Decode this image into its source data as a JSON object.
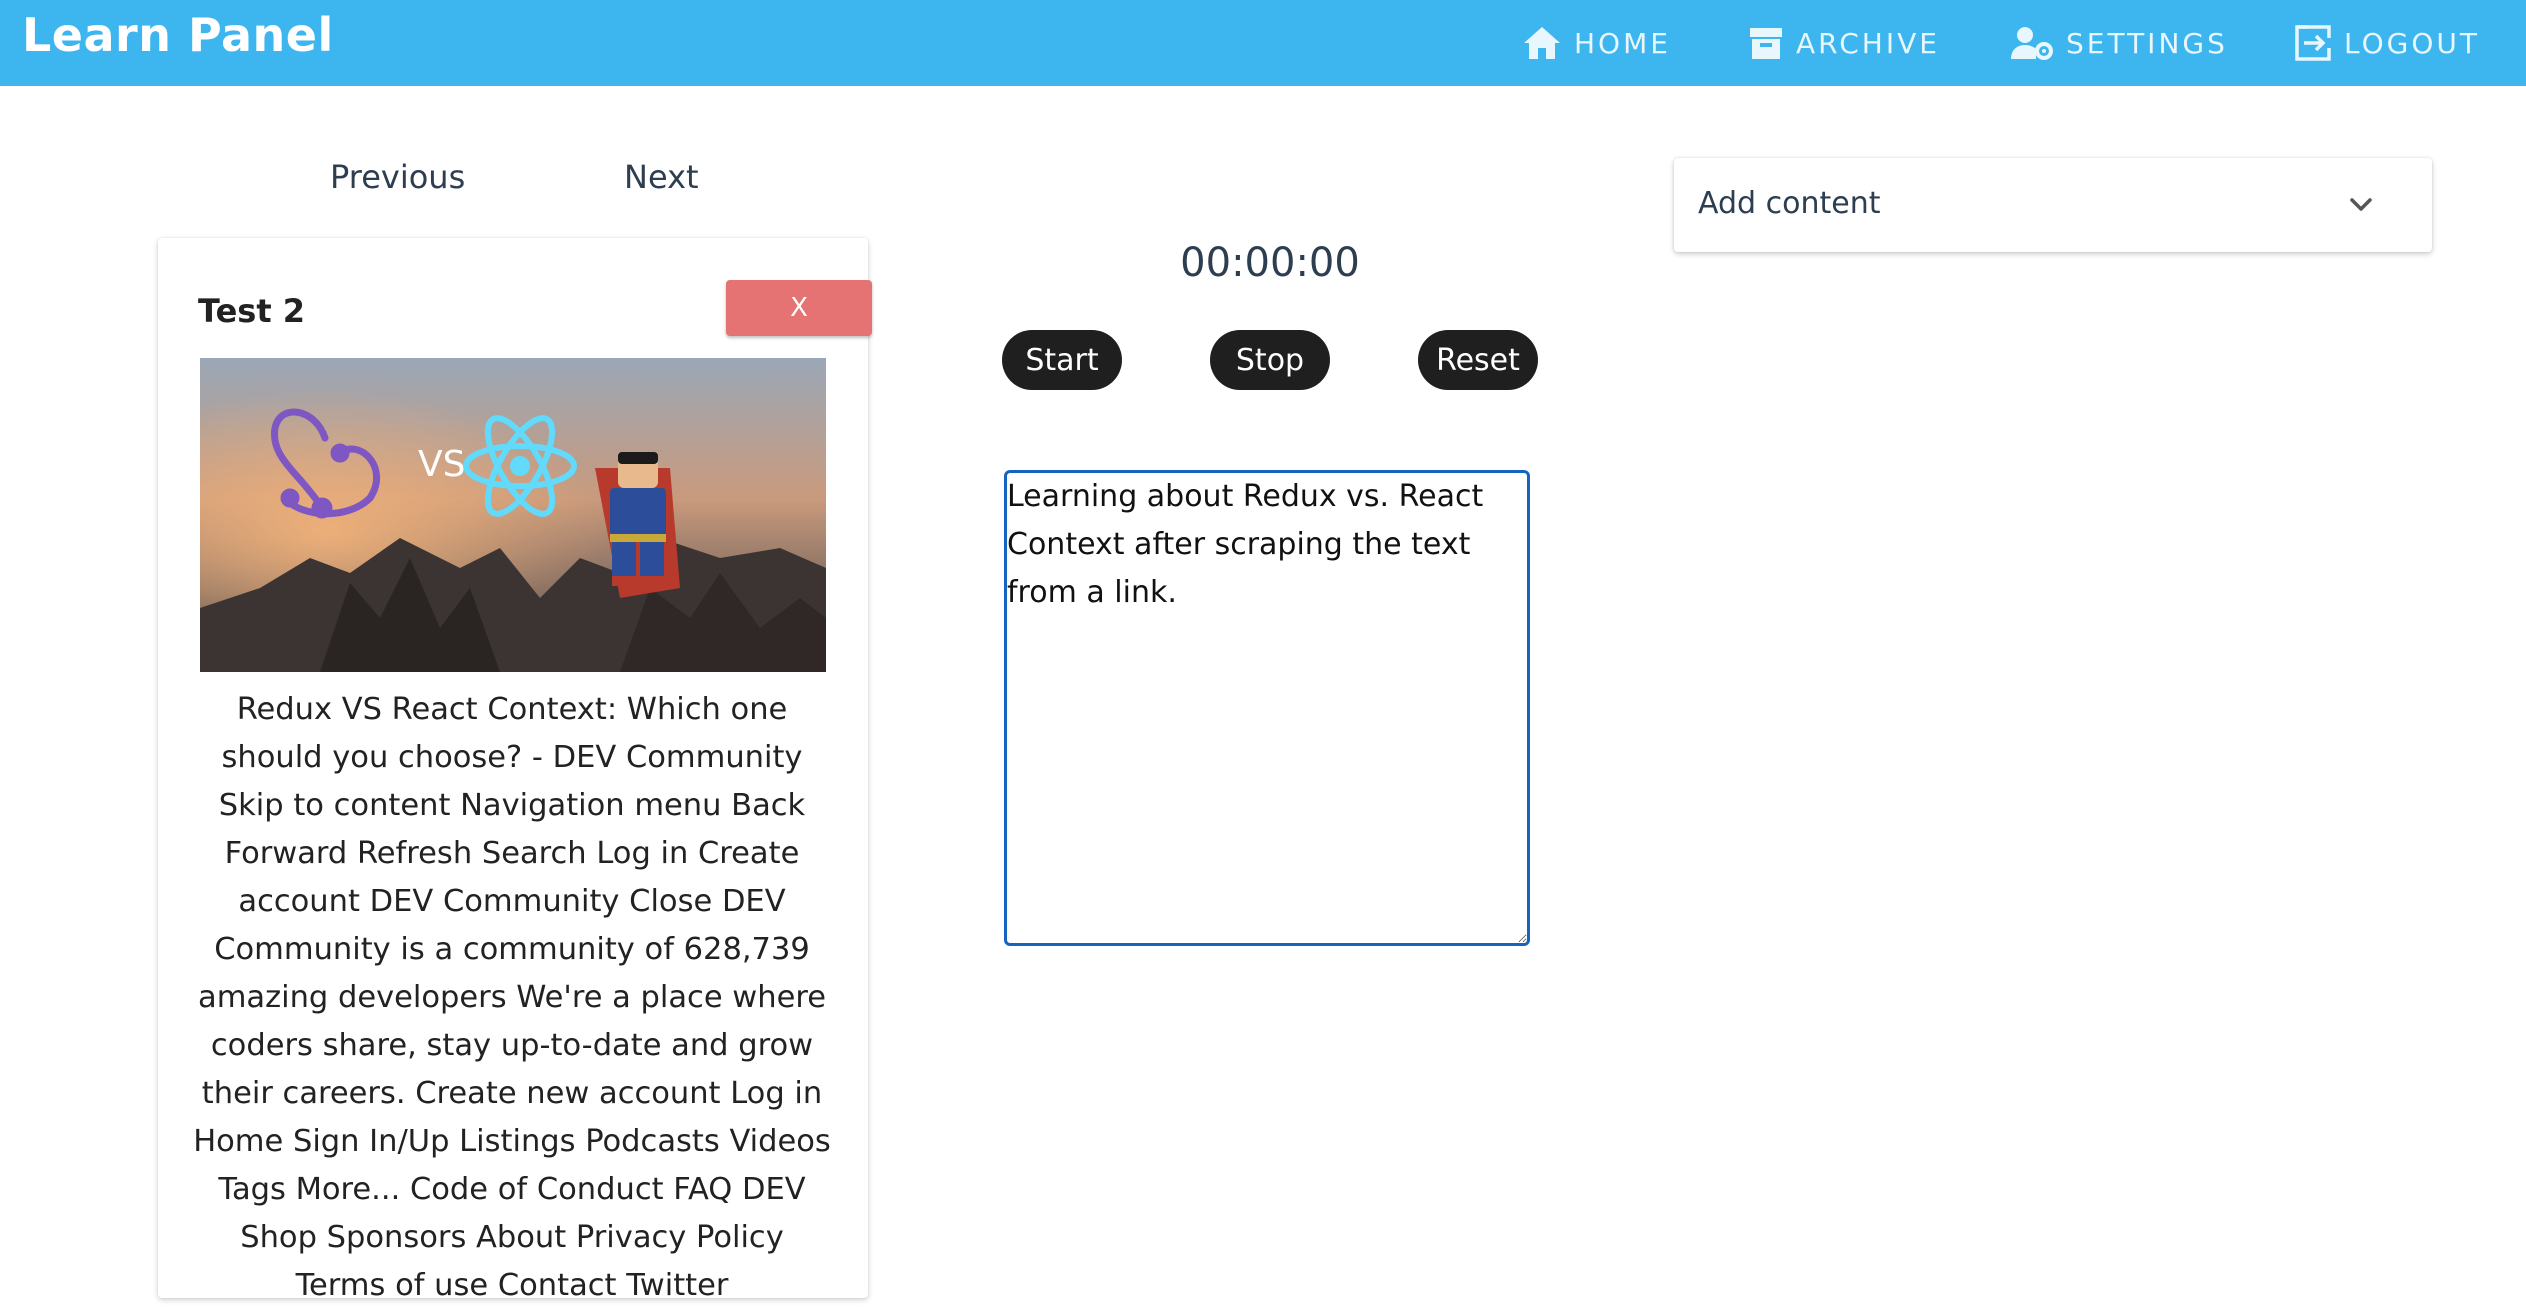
{
  "app": {
    "title": "Learn Panel"
  },
  "nav": {
    "home": "HOME",
    "archive": "ARCHIVE",
    "settings": "SETTINGS",
    "logout": "LOGOUT"
  },
  "pager": {
    "previous": "Previous",
    "next": "Next"
  },
  "card": {
    "title": "Test 2",
    "delete_label": "X",
    "image_text": "VS",
    "body": "Redux VS React Context: Which one should you choose? - DEV Community Skip to content Navigation menu Back Forward Refresh Search Log in Create account DEV Community Close DEV Community is a community of 628,739 amazing developers We're a place where coders share, stay up-to-date and grow their careers. Create new account Log in Home Sign In/Up Listings Podcasts Videos Tags More... Code of Conduct FAQ DEV Shop Sponsors About Privacy Policy Terms of use Contact Twitter"
  },
  "timer": {
    "display": "00:00:00",
    "start": "Start",
    "stop": "Stop",
    "reset": "Reset"
  },
  "notes": {
    "value": "Learning about Redux vs. React Context after scraping the text from a link."
  },
  "dropdown": {
    "label": "Add content"
  },
  "colors": {
    "header": "#3db5ef",
    "delete": "#e57373",
    "pill": "#1f1f1f",
    "focus_border": "#1565c0"
  }
}
